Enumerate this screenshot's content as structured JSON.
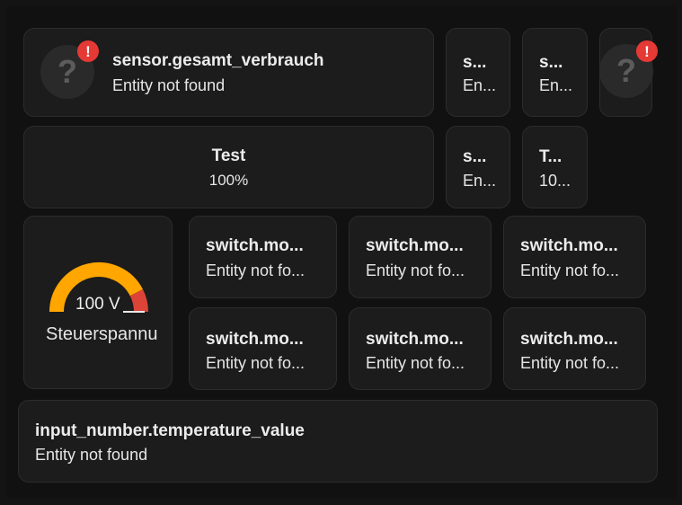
{
  "cards": {
    "gesamt": {
      "name": "sensor.gesamt_verbrauch",
      "state": "Entity not found",
      "icon": "question-mark-icon",
      "badge": "!"
    },
    "small1": {
      "name": "s...",
      "state": "En..."
    },
    "small2": {
      "name": "s...",
      "state": "En..."
    },
    "small3": {
      "icon": "question-mark-icon",
      "badge": "!"
    },
    "test": {
      "name": "Test",
      "state": "100%"
    },
    "small4": {
      "name": "s...",
      "state": "En..."
    },
    "small5": {
      "name": "T...",
      "state": "10..."
    },
    "gauge": {
      "value": "100 V",
      "label": "Steuerspannu",
      "fraction": 0.85,
      "colors": {
        "warn": "#ffa600",
        "severe": "#db4437"
      }
    },
    "sw": [
      {
        "name": "switch.mo...",
        "state": "Entity not fo..."
      },
      {
        "name": "switch.mo...",
        "state": "Entity not fo..."
      },
      {
        "name": "switch.mo...",
        "state": "Entity not fo..."
      },
      {
        "name": "switch.mo...",
        "state": "Entity not fo..."
      },
      {
        "name": "switch.mo...",
        "state": "Entity not fo..."
      },
      {
        "name": "switch.mo...",
        "state": "Entity not fo..."
      }
    ],
    "input": {
      "name": "input_number.temperature_value",
      "state": "Entity not found"
    }
  },
  "colors": {
    "background": "#111111",
    "card": "#1c1c1c",
    "error": "#e53935"
  }
}
